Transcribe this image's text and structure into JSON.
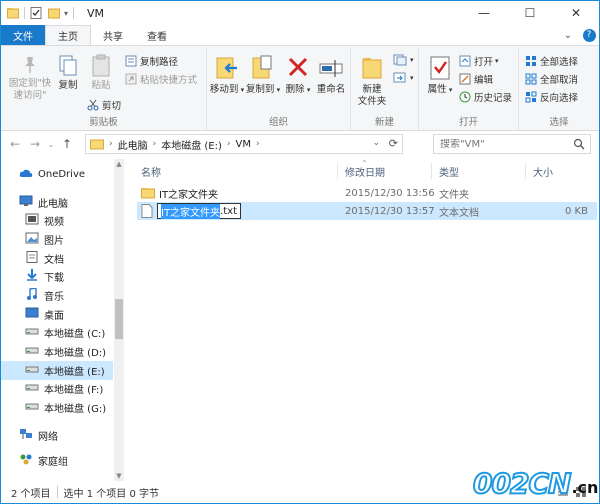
{
  "window": {
    "title": "VM",
    "controls": {
      "minimize": "—",
      "maximize": "☐",
      "close": "✕"
    }
  },
  "ribbon_tabs": {
    "file": "文件",
    "home": "主页",
    "share": "共享",
    "view": "查看"
  },
  "ribbon": {
    "clipboard": {
      "group_label": "剪贴板",
      "pin_quick_access": "固定到\"快速访问\"",
      "copy": "复制",
      "paste": "粘贴",
      "copy_path": "复制路径",
      "paste_shortcut": "粘贴快捷方式",
      "cut": "剪切"
    },
    "organize": {
      "group_label": "组织",
      "move_to": "移动到",
      "copy_to": "复制到",
      "delete": "删除",
      "rename": "重命名"
    },
    "new": {
      "group_label": "新建",
      "new_folder_line1": "新建",
      "new_folder_line2": "文件夹"
    },
    "open": {
      "group_label": "打开",
      "properties": "属性",
      "open": "打开",
      "edit": "编辑",
      "history": "历史记录"
    },
    "select": {
      "group_label": "选择",
      "select_all": "全部选择",
      "select_none": "全部取消",
      "invert": "反向选择"
    }
  },
  "address": {
    "crumbs": [
      "此电脑",
      "本地磁盘 (E:)",
      "VM"
    ],
    "search_placeholder": "搜索\"VM\""
  },
  "nav_pane": {
    "items": [
      {
        "label": "OneDrive",
        "icon": "cloud-icon"
      },
      {
        "label": "此电脑",
        "icon": "computer-icon"
      },
      {
        "label": "视频",
        "icon": "video-icon"
      },
      {
        "label": "图片",
        "icon": "picture-icon"
      },
      {
        "label": "文档",
        "icon": "document-icon"
      },
      {
        "label": "下载",
        "icon": "download-icon"
      },
      {
        "label": "音乐",
        "icon": "music-icon"
      },
      {
        "label": "桌面",
        "icon": "desktop-icon"
      },
      {
        "label": "本地磁盘 (C:)",
        "icon": "drive-icon"
      },
      {
        "label": "本地磁盘 (D:)",
        "icon": "drive-icon"
      },
      {
        "label": "本地磁盘 (E:)",
        "icon": "drive-icon"
      },
      {
        "label": "本地磁盘 (F:)",
        "icon": "drive-icon"
      },
      {
        "label": "本地磁盘 (G:)",
        "icon": "drive-icon"
      },
      {
        "label": "网络",
        "icon": "network-icon"
      },
      {
        "label": "家庭组",
        "icon": "homegroup-icon"
      }
    ],
    "selected": "本地磁盘 (E:)"
  },
  "file_list": {
    "columns": {
      "name": "名称",
      "modified": "修改日期",
      "type": "类型",
      "size": "大小"
    },
    "rows": [
      {
        "name": "IT之家文件夹",
        "modified": "2015/12/30 13:56",
        "type": "文件夹",
        "size": ""
      },
      {
        "name_selected": "IT之家文件夹",
        "name_ext": ".txt",
        "modified": "2015/12/30 13:57",
        "type": "文本文档",
        "size": "0 KB"
      }
    ]
  },
  "status": {
    "item_count": "2 个项目",
    "selection": "选中 1 个项目 0 字节"
  },
  "watermark": {
    "logo": "002CN",
    "tld": ".cn"
  },
  "colors": {
    "accent": "#1979ca",
    "selection": "#cce8ff",
    "folder": "#f8d775"
  }
}
